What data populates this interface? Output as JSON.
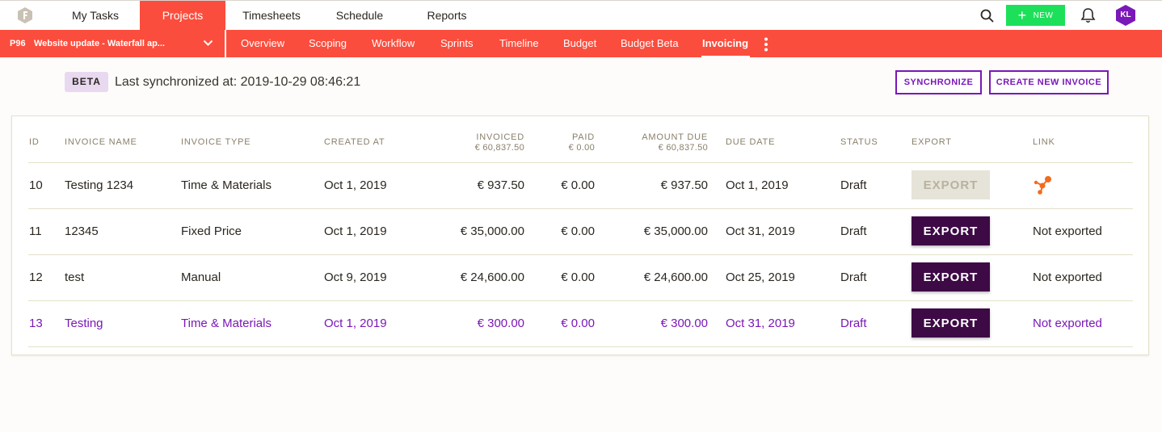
{
  "topnav": {
    "items": [
      "My Tasks",
      "Projects",
      "Timesheets",
      "Schedule",
      "Reports"
    ],
    "active": "Projects",
    "new_label": "NEW",
    "avatar_initials": "KL",
    "accent": "#fb4d3d",
    "new_color": "#1de05a",
    "avatar_color": "#7a18b8"
  },
  "subnav": {
    "project_code": "P96",
    "project_name": "Website update - Waterfall ap...",
    "items": [
      "Overview",
      "Scoping",
      "Workflow",
      "Sprints",
      "Timeline",
      "Budget",
      "Budget Beta",
      "Invoicing"
    ],
    "active": "Invoicing"
  },
  "sync": {
    "badge": "BETA",
    "text": "Last synchronized at: 2019-10-29 08:46:21",
    "sync_button": "SYNCHRONIZE",
    "create_button": "CREATE NEW INVOICE"
  },
  "table": {
    "headers": {
      "id": "ID",
      "name": "INVOICE NAME",
      "type": "INVOICE TYPE",
      "created": "CREATED AT",
      "invoiced": "INVOICED",
      "invoiced_total": "€ 60,837.50",
      "paid": "PAID",
      "paid_total": "€ 0.00",
      "amount_due": "AMOUNT DUE",
      "amount_due_total": "€ 60,837.50",
      "due_date": "DUE DATE",
      "status": "STATUS",
      "export": "EXPORT",
      "link": "LINK"
    },
    "rows": [
      {
        "id": "10",
        "name": "Testing 1234",
        "type": "Time & Materials",
        "created": "Oct 1, 2019",
        "invoiced": "€ 937.50",
        "paid": "€ 0.00",
        "amount_due": "€ 937.50",
        "due_date": "Oct 1, 2019",
        "status": "Draft",
        "export": "EXPORT",
        "link": ""
      },
      {
        "id": "11",
        "name": "12345",
        "type": "Fixed Price",
        "created": "Oct 1, 2019",
        "invoiced": "€ 35,000.00",
        "paid": "€ 0.00",
        "amount_due": "€ 35,000.00",
        "due_date": "Oct 31, 2019",
        "status": "Draft",
        "export": "EXPORT",
        "link": "Not exported"
      },
      {
        "id": "12",
        "name": "test",
        "type": "Manual",
        "created": "Oct 9, 2019",
        "invoiced": "€ 24,600.00",
        "paid": "€ 0.00",
        "amount_due": "€ 24,600.00",
        "due_date": "Oct 25, 2019",
        "status": "Draft",
        "export": "EXPORT",
        "link": "Not exported"
      },
      {
        "id": "13",
        "name": "Testing",
        "type": "Time & Materials",
        "created": "Oct 1, 2019",
        "invoiced": "€ 300.00",
        "paid": "€ 0.00",
        "amount_due": "€ 300.00",
        "due_date": "Oct 31, 2019",
        "status": "Draft",
        "export": "EXPORT",
        "link": "Not exported"
      }
    ]
  }
}
